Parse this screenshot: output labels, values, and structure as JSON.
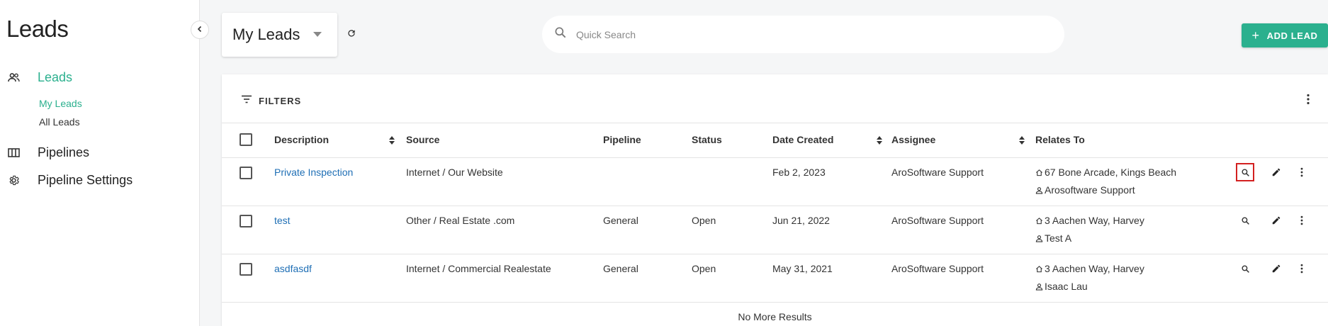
{
  "sidebar": {
    "title": "Leads",
    "nav": [
      {
        "label": "Leads",
        "icon": "people-icon",
        "active": true
      },
      {
        "label": "Pipelines",
        "icon": "columns-icon",
        "active": false
      },
      {
        "label": "Pipeline Settings",
        "icon": "gear-icon",
        "active": false
      }
    ],
    "subitems": [
      {
        "label": "My Leads",
        "active": true
      },
      {
        "label": "All Leads",
        "active": false
      }
    ]
  },
  "topbar": {
    "view_title": "My Leads",
    "search_placeholder": "Quick Search",
    "search_value": "",
    "add_button_label": "ADD LEAD"
  },
  "card": {
    "filters_label": "FILTERS",
    "columns": [
      "Description",
      "Source",
      "Pipeline",
      "Status",
      "Date Created",
      "Assignee",
      "Relates To"
    ],
    "rows": [
      {
        "description": "Private Inspection",
        "source": "Internet / Our Website",
        "pipeline": "",
        "status": "",
        "date_created": "Feb 2, 2023",
        "assignee": "AroSoftware Support",
        "relates_address": "67 Bone Arcade, Kings Beach",
        "relates_person": "Arosoftware Support"
      },
      {
        "description": "test",
        "source": "Other / Real Estate .com",
        "pipeline": "General",
        "status": "Open",
        "date_created": "Jun 21, 2022",
        "assignee": "AroSoftware Support",
        "relates_address": "3 Aachen Way, Harvey",
        "relates_person": "Test A"
      },
      {
        "description": "asdfasdf",
        "source": "Internet / Commercial Realestate",
        "pipeline": "General",
        "status": "Open",
        "date_created": "May 31, 2021",
        "assignee": "AroSoftware Support",
        "relates_address": "3 Aachen Way, Harvey",
        "relates_person": "Isaac Lau"
      }
    ],
    "footer": "No More Results"
  },
  "colors": {
    "accent": "#2bb08e",
    "link": "#1f6fb5",
    "highlight": "#d32020"
  }
}
